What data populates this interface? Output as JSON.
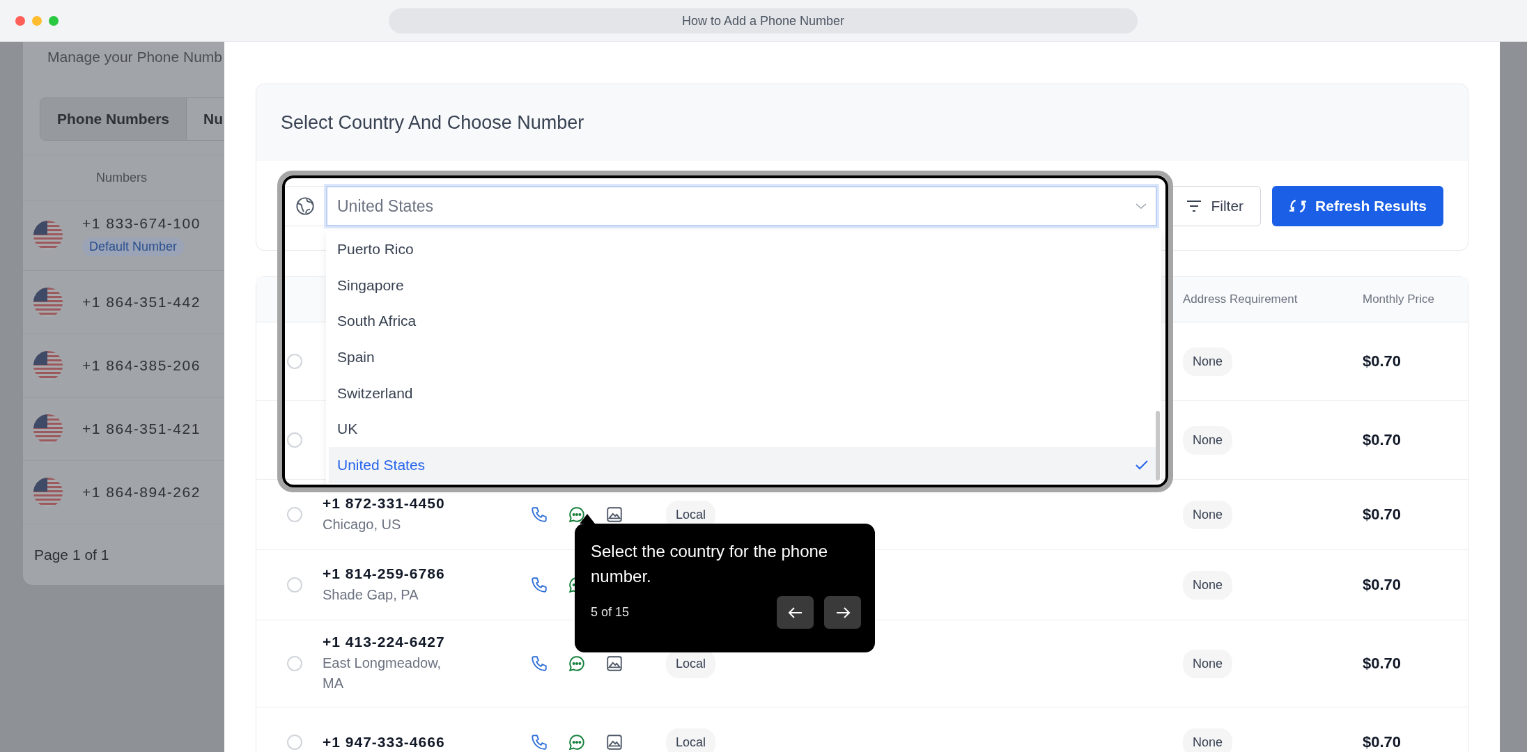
{
  "browser": {
    "title": "How to Add a Phone Number"
  },
  "background_page": {
    "subtitle": "Manage your Phone Numb",
    "tabs": [
      {
        "label": "Phone Numbers",
        "selected": true
      },
      {
        "label": "Nu",
        "selected": false
      }
    ],
    "column": "Numbers",
    "numbers": [
      {
        "number": "+1 833-674-100",
        "badge": "Default Number"
      },
      {
        "number": "+1 864-351-442"
      },
      {
        "number": "+1 864-385-206"
      },
      {
        "number": "+1 864-351-421"
      },
      {
        "number": "+1 864-894-262"
      }
    ],
    "pagination": "Page 1 of 1"
  },
  "section": {
    "title": "Select Country And Choose Number",
    "country_select": {
      "value": "United States",
      "options": [
        {
          "label": "Puerto Rico",
          "selected": false
        },
        {
          "label": "Singapore",
          "selected": false
        },
        {
          "label": "South Africa",
          "selected": false
        },
        {
          "label": "Spain",
          "selected": false
        },
        {
          "label": "Switzerland",
          "selected": false
        },
        {
          "label": "UK",
          "selected": false
        },
        {
          "label": "United States",
          "selected": true
        }
      ]
    },
    "filter_button": "Filter",
    "refresh_button": "Refresh Results"
  },
  "table": {
    "columns": [
      "Address Requirement",
      "Monthly Price"
    ],
    "rows": [
      {
        "selected": false,
        "address": "None",
        "price": "$0.70"
      },
      {
        "selected": false,
        "address": "None",
        "price": "$0.70"
      },
      {
        "selected": false,
        "number": "+1 872-331-4450",
        "location": "Chicago, US",
        "type": "Local",
        "address": "None",
        "price": "$0.70"
      },
      {
        "selected": false,
        "number": "+1 814-259-6786",
        "location": "Shade Gap, PA",
        "address": "None",
        "price": "$0.70"
      },
      {
        "selected": false,
        "number": "+1 413-224-6427",
        "location": "East Longmeadow, MA",
        "type": "Local",
        "address": "None",
        "price": "$0.70"
      },
      {
        "selected": false,
        "number": "+1 947-333-4666",
        "type": "Local",
        "address": "None",
        "price": "$0.70"
      }
    ]
  },
  "tooltip": {
    "text": "Select the country for the phone number.",
    "progress": "5 of 15"
  }
}
